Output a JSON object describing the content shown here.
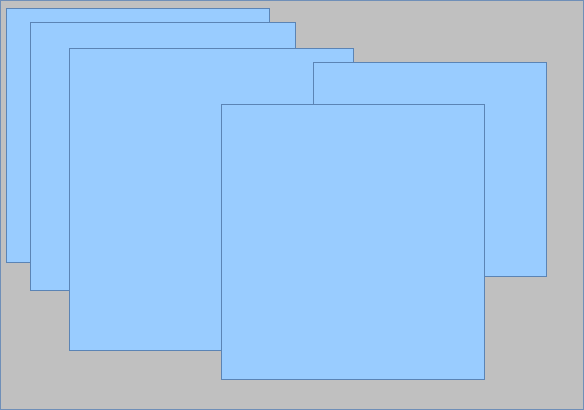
{
  "canvas": {
    "background_color": "#c0c0c0",
    "border_color": "#6f8fb8"
  },
  "panels": [
    {
      "id": "panel-1",
      "fill_color": "#99ccff",
      "border_color": "#5b84b5"
    },
    {
      "id": "panel-2",
      "fill_color": "#99ccff",
      "border_color": "#5b84b5"
    },
    {
      "id": "panel-3",
      "fill_color": "#99ccff",
      "border_color": "#5b84b5"
    },
    {
      "id": "panel-4",
      "fill_color": "#99ccff",
      "border_color": "#5b84b5"
    },
    {
      "id": "panel-5",
      "fill_color": "#99ccff",
      "border_color": "#5b84b5"
    }
  ]
}
